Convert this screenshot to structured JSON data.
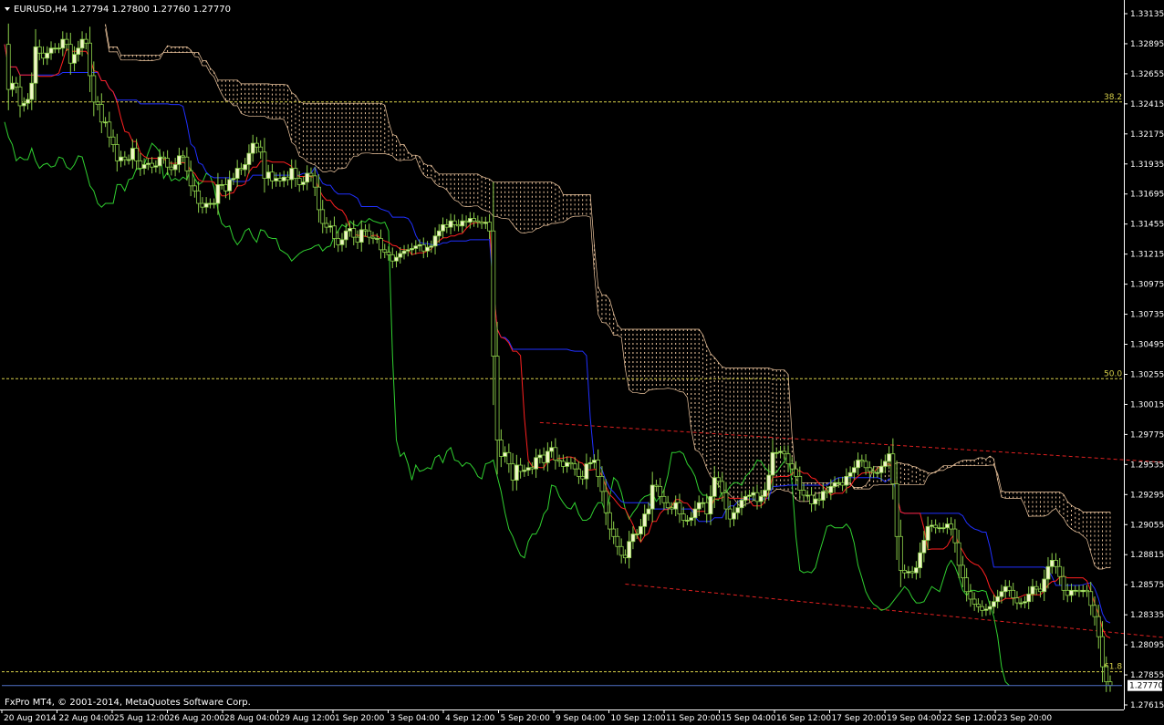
{
  "header": {
    "symbol_timeframe": "EURUSD,H4",
    "ohlc": "1.27794 1.27800 1.27760 1.27770"
  },
  "footer": {
    "copyright": "FxPro MT4, © 2001-2014, MetaQuotes Software Corp."
  },
  "colors": {
    "background": "#000000",
    "axis": "#ffffff",
    "candle_up_fill": "#f0f6c8",
    "candle_outline": "#8ccf4a",
    "tenkan": "#ff2020",
    "kijun": "#2030ff",
    "chikou": "#30d030",
    "cloud_dots": "#f0c8a0",
    "channel": "#e02020",
    "fib": "#d8d14a",
    "bid_line": "#5070c8"
  },
  "chart_data": {
    "type": "candlestick",
    "symbol": "EURUSD",
    "timeframe": "H4",
    "last_price": "1.27770",
    "y_ticks": [
      "1.33135",
      "1.32895",
      "1.32655",
      "1.32415",
      "1.32175",
      "1.31935",
      "1.31695",
      "1.31455",
      "1.31215",
      "1.30975",
      "1.30735",
      "1.30495",
      "1.30255",
      "1.30015",
      "1.29775",
      "1.29535",
      "1.29295",
      "1.29055",
      "1.28815",
      "1.28575",
      "1.28335",
      "1.28095",
      "1.27855",
      "1.27615"
    ],
    "x_ticks": [
      "20 Aug 2014",
      "22 Aug 04:00",
      "25 Aug 12:00",
      "26 Aug 20:00",
      "28 Aug 04:00",
      "29 Aug 12:00",
      "1 Sep 20:00",
      "3 Sep 04:00",
      "4 Sep 12:00",
      "5 Sep 20:00",
      "9 Sep 04:00",
      "10 Sep 12:00",
      "11 Sep 20:00",
      "15 Sep 04:00",
      "16 Sep 12:00",
      "17 Sep 20:00",
      "19 Sep 04:00",
      "22 Sep 12:00",
      "23 Sep 20:00"
    ],
    "fib_levels": [
      {
        "label": "38.2",
        "price": 1.3243
      },
      {
        "label": "50.0",
        "price": 1.3022
      },
      {
        "label": "61.8",
        "price": 1.2788
      }
    ],
    "bid_price": 1.2777,
    "channel_upper": [
      {
        "bar": 138,
        "price": 1.2987
      },
      {
        "bar": 300,
        "price": 1.2955
      }
    ],
    "channel_lower": [
      {
        "bar": 160,
        "price": 1.2858
      },
      {
        "bar": 300,
        "price": 1.2815
      }
    ],
    "prices": [
      1.3289,
      1.3253,
      1.3258,
      1.3255,
      1.324,
      1.3242,
      1.3245,
      1.3258,
      1.3287,
      1.3282,
      1.3278,
      1.3282,
      1.3286,
      1.3286,
      1.3286,
      1.3293,
      1.3289,
      1.3274,
      1.3281,
      1.3286,
      1.3293,
      1.329,
      1.3264,
      1.3243,
      1.3241,
      1.3227,
      1.3227,
      1.3215,
      1.3209,
      1.3196,
      1.3199,
      1.3197,
      1.3197,
      1.3206,
      1.3196,
      1.319,
      1.3193,
      1.3194,
      1.3191,
      1.3192,
      1.3199,
      1.3198,
      1.3191,
      1.3189,
      1.3193,
      1.32,
      1.3199,
      1.3188,
      1.3176,
      1.3172,
      1.3162,
      1.3159,
      1.3162,
      1.3162,
      1.3162,
      1.3177,
      1.3177,
      1.3172,
      1.3181,
      1.3182,
      1.319,
      1.3189,
      1.3193,
      1.3202,
      1.321,
      1.3207,
      1.3203,
      1.3182,
      1.3187,
      1.318,
      1.3182,
      1.318,
      1.3183,
      1.3181,
      1.319,
      1.3182,
      1.3177,
      1.3179,
      1.3186,
      1.3184,
      1.3175,
      1.3157,
      1.3146,
      1.3143,
      1.3144,
      1.3134,
      1.3129,
      1.3133,
      1.314,
      1.3142,
      1.3135,
      1.3131,
      1.3141,
      1.314,
      1.3135,
      1.3134,
      1.3134,
      1.3125,
      1.3123,
      1.3121,
      1.3116,
      1.3119,
      1.3122,
      1.3124,
      1.3125,
      1.3126,
      1.3128,
      1.3129,
      1.3124,
      1.3127,
      1.3128,
      1.3136,
      1.314,
      1.3145,
      1.3143,
      1.3148,
      1.3145,
      1.3144,
      1.3148,
      1.3147,
      1.315,
      1.3148,
      1.3147,
      1.3146,
      1.3147,
      1.314,
      1.304,
      1.2973,
      1.296,
      1.2963,
      1.2954,
      1.2941,
      1.2953,
      1.2948,
      1.2949,
      1.2951,
      1.295,
      1.2959,
      1.2961,
      1.2955,
      1.2964,
      1.2967,
      1.2957,
      1.2956,
      1.2952,
      1.2955,
      1.2954,
      1.295,
      1.2944,
      1.2942,
      1.2954,
      1.2955,
      1.2957,
      1.2944,
      1.2932,
      1.2915,
      1.2902,
      1.2896,
      1.2888,
      1.2881,
      1.2879,
      1.2892,
      1.2898,
      1.2898,
      1.2904,
      1.2914,
      1.2918,
      1.2937,
      1.2936,
      1.2928,
      1.2923,
      1.2919,
      1.2918,
      1.2923,
      1.2914,
      1.2909,
      1.2909,
      1.2911,
      1.2918,
      1.2923,
      1.2923,
      1.2914,
      1.2928,
      1.2943,
      1.294,
      1.2931,
      1.2918,
      1.291,
      1.2915,
      1.2919,
      1.2925,
      1.2928,
      1.2929,
      1.2931,
      1.2924,
      1.2928,
      1.2933,
      1.2945,
      1.2963,
      1.2963,
      1.2964,
      1.2962,
      1.2954,
      1.295,
      1.2944,
      1.2933,
      1.2929,
      1.2929,
      1.2922,
      1.2926,
      1.2925,
      1.2932,
      1.2931,
      1.2936,
      1.2939,
      1.2939,
      1.2937,
      1.2944,
      1.2947,
      1.2951,
      1.2957,
      1.2956,
      1.2951,
      1.2948,
      1.2947,
      1.2947,
      1.2952,
      1.2956,
      1.2962,
      1.2938,
      1.2896,
      1.2869,
      1.2867,
      1.2868,
      1.2867,
      1.2871,
      1.2883,
      1.2893,
      1.2904,
      1.2905,
      1.2903,
      1.2903,
      1.2903,
      1.2906,
      1.2902,
      1.2891,
      1.2873,
      1.2863,
      1.2852,
      1.2846,
      1.2842,
      1.284,
      1.2837,
      1.2838,
      1.284,
      1.2844,
      1.2848,
      1.2852,
      1.2856,
      1.2853,
      1.2847,
      1.2843,
      1.2843,
      1.2844,
      1.285,
      1.2856,
      1.2854,
      1.2852,
      1.2862,
      1.2872,
      1.2877,
      1.2872,
      1.2864,
      1.2853,
      1.2849,
      1.2853,
      1.2853,
      1.2852,
      1.2853,
      1.2852,
      1.2841,
      1.2832,
      1.2816,
      1.2792,
      1.278,
      1.2777
    ]
  }
}
